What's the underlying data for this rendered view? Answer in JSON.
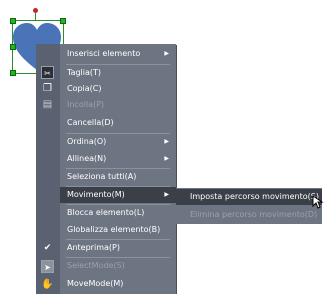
{
  "shape": {
    "fill": "#4a73b8",
    "selection_color": "#22b422",
    "rotate_handle_color": "#c62828"
  },
  "menu": {
    "bg": "#6e7582",
    "items": [
      {
        "label": "Inserisci elemento",
        "disabled": false,
        "submenu": true
      },
      {
        "label": "Taglia(T)",
        "disabled": false
      },
      {
        "label": "Copia(C)",
        "disabled": false
      },
      {
        "label": "Incolla(P)",
        "disabled": true
      },
      {
        "label": "Cancella(D)",
        "disabled": false
      },
      {
        "label": "Ordina(O)",
        "disabled": false,
        "submenu": true
      },
      {
        "label": "Allinea(N)",
        "disabled": false,
        "submenu": true
      },
      {
        "label": "Seleziona tutti(A)",
        "disabled": false
      },
      {
        "label": "Movimento(M)",
        "disabled": false,
        "submenu": true,
        "active": true
      },
      {
        "label": "Blocca elemento(L)",
        "disabled": false
      },
      {
        "label": "Globalizza elemento(B)",
        "disabled": false
      },
      {
        "label": "Anteprima(P)",
        "disabled": false,
        "checked": true
      },
      {
        "label": "SelectMode(S)",
        "disabled": true
      },
      {
        "label": "MoveMode(M)",
        "disabled": false
      }
    ]
  },
  "submenu": {
    "items": [
      {
        "label": "Imposta percorso movimento(S)",
        "active": true
      },
      {
        "label": "Elimina percorso movimento(D)",
        "disabled": true
      }
    ]
  },
  "icons": {
    "cut": "cut-icon",
    "copy": "copy-icon",
    "paste": "paste-icon",
    "check": "check-icon",
    "select": "select-mode-icon",
    "move": "move-mode-icon"
  }
}
